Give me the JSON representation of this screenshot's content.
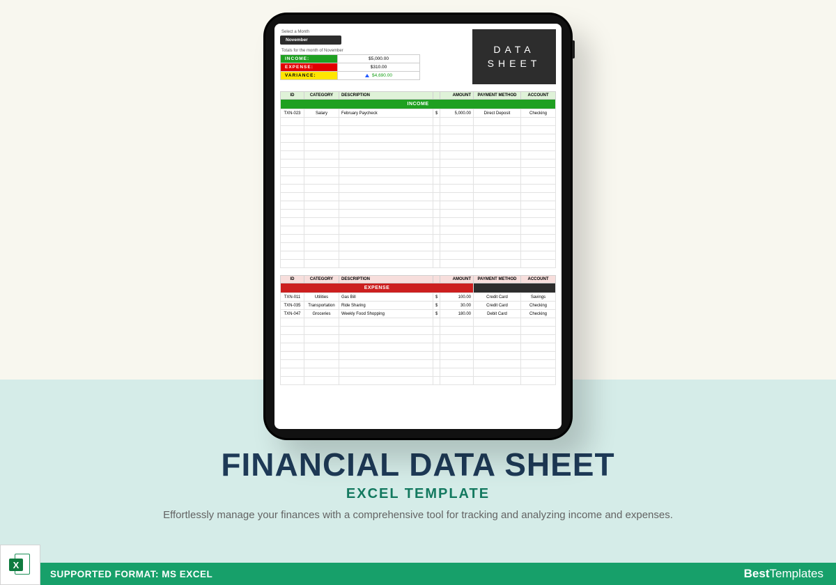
{
  "sheet": {
    "select_label": "Select a Month",
    "month": "November",
    "totals_label": "Totals for the month of November",
    "totals": {
      "income_label": "INCOME:",
      "income_value": "$5,000.00",
      "expense_label": "EXPENSE:",
      "expense_value": "$310.00",
      "variance_label": "VARIANCE:",
      "variance_value": "$4,690.00"
    },
    "badge_line1": "DATA",
    "badge_line2": "SHEET",
    "columns": {
      "id": "ID",
      "category": "CATEGORY",
      "description": "DESCRIPTION",
      "amount": "AMOUNT",
      "payment": "PAYMENT METHOD",
      "account": "ACCOUNT"
    },
    "income_title": "INCOME",
    "expense_title": "EXPENSE",
    "currency": "$",
    "income_rows": [
      {
        "id": "TXN-023",
        "category": "Salary",
        "description": "February Paycheck",
        "amount": "5,000.00",
        "payment": "Direct Deposit",
        "account": "Checking"
      }
    ],
    "expense_rows": [
      {
        "id": "TXN-011",
        "category": "Utilities",
        "description": "Gas Bill",
        "amount": "100.00",
        "payment": "Credit Card",
        "account": "Savings"
      },
      {
        "id": "TXN-035",
        "category": "Transportation",
        "description": "Ride Sharing",
        "amount": "30.00",
        "payment": "Credit Card",
        "account": "Checking"
      },
      {
        "id": "TXN-047",
        "category": "Groceries",
        "description": "Weekly Food Shopping",
        "amount": "180.00",
        "payment": "Debit Card",
        "account": "Checking"
      }
    ]
  },
  "hero": {
    "title": "FINANCIAL DATA SHEET",
    "subtitle": "EXCEL TEMPLATE",
    "tagline": "Effortlessly manage your finances with a comprehensive tool for tracking and analyzing income and expenses."
  },
  "footer": {
    "format_label": "SUPPORTED FORMAT: ",
    "format_value": "MS EXCEL",
    "brand_bold": "Best",
    "brand_light": "Templates",
    "excel_letter": "X"
  }
}
